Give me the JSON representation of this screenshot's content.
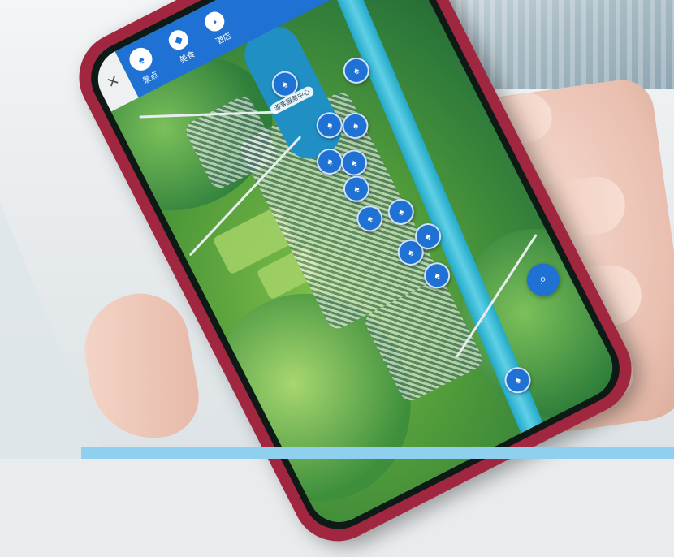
{
  "app": {
    "close_icon_glyph": "✕",
    "accent_color": "#1f72d4",
    "phone_case_color": "#a0273f"
  },
  "tabs": [
    {
      "label": "景点",
      "icon": "pin-icon",
      "glyph": "♠"
    },
    {
      "label": "美食",
      "icon": "food-icon",
      "glyph": "◆"
    },
    {
      "label": "酒店",
      "icon": "hotel-icon",
      "glyph": "•"
    }
  ],
  "map": {
    "search_icon_glyph": "⌕",
    "pins": [
      {
        "label": "游客服务中心",
        "glyph": "♠"
      },
      {
        "label": "",
        "glyph": "♠"
      },
      {
        "label": "",
        "glyph": "♠"
      },
      {
        "label": "",
        "glyph": "♠"
      },
      {
        "label": "",
        "glyph": "♠"
      },
      {
        "label": "",
        "glyph": "♠"
      },
      {
        "label": "",
        "glyph": "♠"
      },
      {
        "label": "",
        "glyph": "♠"
      },
      {
        "label": "",
        "glyph": "♠"
      },
      {
        "label": "",
        "glyph": "♠"
      },
      {
        "label": "",
        "glyph": "♠"
      },
      {
        "label": "",
        "glyph": "♠"
      },
      {
        "label": "",
        "glyph": "♠"
      }
    ]
  }
}
